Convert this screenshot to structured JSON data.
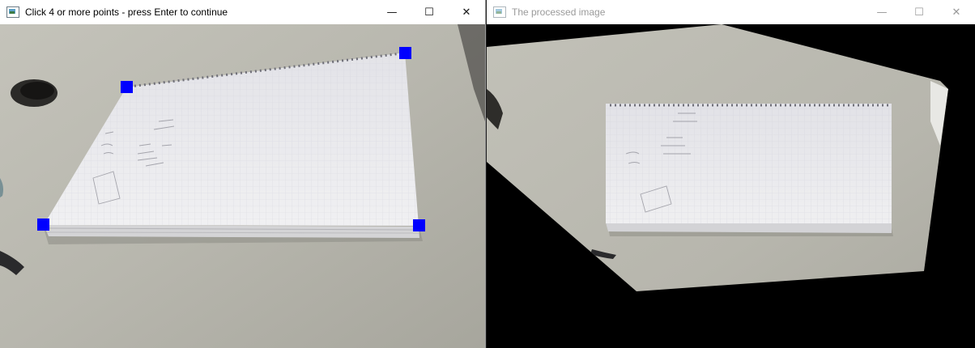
{
  "windows": [
    {
      "title": "Click 4 or more points - press Enter to continue",
      "icon": "app-window-icon",
      "controls": {
        "minimize": "—",
        "maximize": "☐",
        "close": "✕"
      }
    },
    {
      "title": "The processed image",
      "icon": "app-window-icon",
      "controls": {
        "minimize": "—",
        "maximize": "☐",
        "close": "✕"
      }
    }
  ],
  "selected_points_count": 4,
  "colors": {
    "marker": "#0000ff",
    "desk": "#b7b7ae",
    "paper": "#ececee",
    "background_fill": "#000000"
  }
}
